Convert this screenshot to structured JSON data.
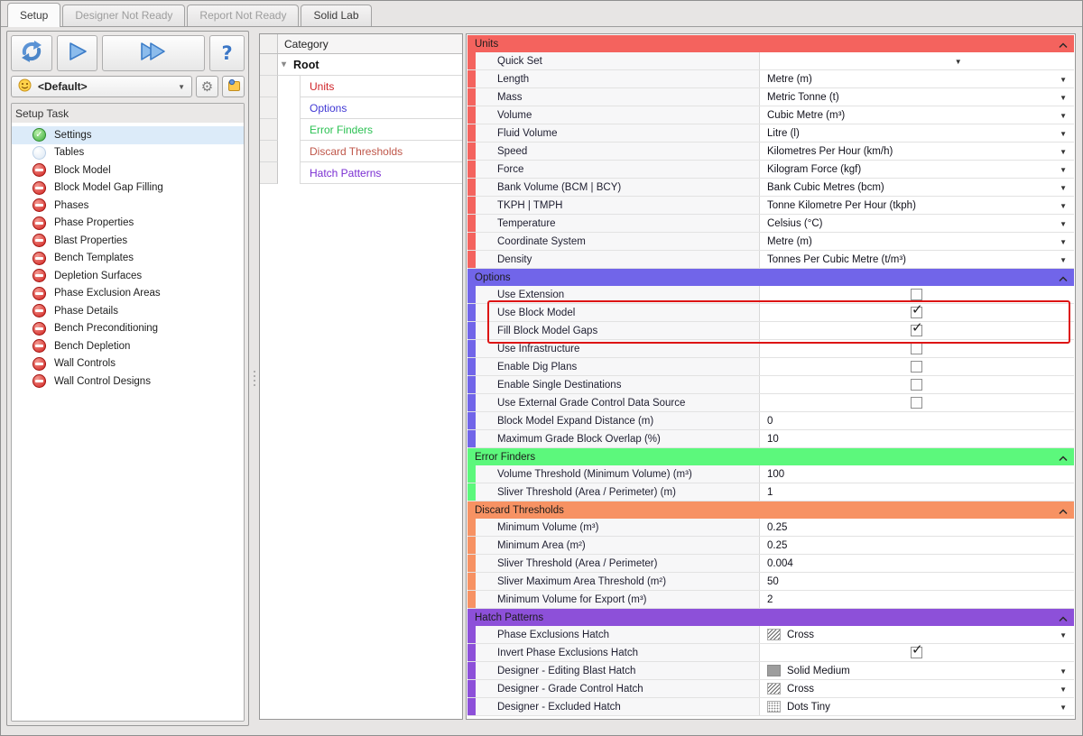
{
  "tabs": [
    {
      "label": "Setup",
      "state": "active"
    },
    {
      "label": "Designer Not Ready",
      "state": "disabled"
    },
    {
      "label": "Report Not Ready",
      "state": "disabled"
    },
    {
      "label": "Solid Lab",
      "state": "normal"
    }
  ],
  "toolbar": {
    "help_glyph": "?",
    "profile": {
      "value": "<Default>"
    }
  },
  "setup_task": {
    "title": "Setup Task",
    "items": [
      {
        "label": "Settings",
        "status": "done",
        "selected": true
      },
      {
        "label": "Tables",
        "status": "pending",
        "selected": false
      },
      {
        "label": "Block Model",
        "status": "blocked",
        "selected": false
      },
      {
        "label": "Block Model Gap Filling",
        "status": "blocked",
        "selected": false
      },
      {
        "label": "Phases",
        "status": "blocked",
        "selected": false
      },
      {
        "label": "Phase Properties",
        "status": "blocked",
        "selected": false
      },
      {
        "label": "Blast Properties",
        "status": "blocked",
        "selected": false
      },
      {
        "label": "Bench Templates",
        "status": "blocked",
        "selected": false
      },
      {
        "label": "Depletion Surfaces",
        "status": "blocked",
        "selected": false
      },
      {
        "label": "Phase Exclusion Areas",
        "status": "blocked",
        "selected": false
      },
      {
        "label": "Phase Details",
        "status": "blocked",
        "selected": false
      },
      {
        "label": "Bench Preconditioning",
        "status": "blocked",
        "selected": false
      },
      {
        "label": "Bench Depletion",
        "status": "blocked",
        "selected": false
      },
      {
        "label": "Wall Controls",
        "status": "blocked",
        "selected": false
      },
      {
        "label": "Wall Control Designs",
        "status": "blocked",
        "selected": false
      }
    ]
  },
  "category_panel": {
    "header": "Category",
    "root": "Root",
    "children": [
      {
        "label": "Units",
        "color": "#cf2429"
      },
      {
        "label": "Options",
        "color": "#4038d4"
      },
      {
        "label": "Error Finders",
        "color": "#2cc153"
      },
      {
        "label": "Discard Thresholds",
        "color": "#bf5649"
      },
      {
        "label": "Hatch Patterns",
        "color": "#7a2ed2"
      }
    ]
  },
  "property_grid": {
    "annotation_color": "#dd1414",
    "sections": [
      {
        "title": "Units",
        "color": "#f4635e",
        "rows": [
          {
            "label": "Quick Set",
            "type": "quickset",
            "value": ""
          },
          {
            "label": "Length",
            "type": "dropdown",
            "value": "Metre (m)"
          },
          {
            "label": "Mass",
            "type": "dropdown",
            "value": "Metric Tonne (t)"
          },
          {
            "label": "Volume",
            "type": "dropdown",
            "value": "Cubic Metre (m³)"
          },
          {
            "label": "Fluid Volume",
            "type": "dropdown",
            "value": "Litre (l)"
          },
          {
            "label": "Speed",
            "type": "dropdown",
            "value": "Kilometres Per Hour (km/h)"
          },
          {
            "label": "Force",
            "type": "dropdown",
            "value": "Kilogram Force (kgf)"
          },
          {
            "label": "Bank Volume (BCM | BCY)",
            "type": "dropdown",
            "value": "Bank Cubic Metres (bcm)"
          },
          {
            "label": "TKPH | TMPH",
            "type": "dropdown",
            "value": "Tonne Kilometre Per Hour (tkph)"
          },
          {
            "label": "Temperature",
            "type": "dropdown",
            "value": "Celsius (°C)"
          },
          {
            "label": "Coordinate System",
            "type": "dropdown",
            "value": "Metre (m)"
          },
          {
            "label": "Density",
            "type": "dropdown",
            "value": "Tonnes Per Cubic Metre (t/m³)"
          }
        ]
      },
      {
        "title": "Options",
        "color": "#7165e9",
        "rows": [
          {
            "label": "Use Extension",
            "type": "checkbox",
            "checked": false
          },
          {
            "label": "Use Block Model",
            "type": "checkbox",
            "checked": true,
            "highlight": true
          },
          {
            "label": "Fill Block Model Gaps",
            "type": "checkbox",
            "checked": true,
            "highlight": true
          },
          {
            "label": "Use Infrastructure",
            "type": "checkbox",
            "checked": false
          },
          {
            "label": "Enable Dig Plans",
            "type": "checkbox",
            "checked": false
          },
          {
            "label": "Enable Single Destinations",
            "type": "checkbox",
            "checked": false
          },
          {
            "label": "Use External Grade Control Data Source",
            "type": "checkbox",
            "checked": false
          },
          {
            "label": "Block Model Expand Distance (m)",
            "type": "text",
            "value": "0"
          },
          {
            "label": "Maximum Grade Block Overlap (%)",
            "type": "text",
            "value": "10"
          }
        ]
      },
      {
        "title": "Error Finders",
        "color": "#5cf87c",
        "rows": [
          {
            "label": "Volume Threshold (Minimum Volume) (m³)",
            "type": "text",
            "value": "100"
          },
          {
            "label": "Sliver Threshold (Area / Perimeter) (m)",
            "type": "text",
            "value": "1"
          }
        ]
      },
      {
        "title": "Discard Thresholds",
        "color": "#f79263",
        "rows": [
          {
            "label": "Minimum Volume (m³)",
            "type": "text",
            "value": "0.25"
          },
          {
            "label": "Minimum Area (m²)",
            "type": "text",
            "value": "0.25"
          },
          {
            "label": "Sliver Threshold (Area / Perimeter)",
            "type": "text",
            "value": "0.004"
          },
          {
            "label": "Sliver Maximum Area Threshold (m²)",
            "type": "text",
            "value": "50"
          },
          {
            "label": "Minimum Volume for Export (m³)",
            "type": "text",
            "value": "2"
          }
        ]
      },
      {
        "title": "Hatch Patterns",
        "color": "#8d50d9",
        "rows": [
          {
            "label": "Phase Exclusions Hatch",
            "type": "hatch",
            "swatch": "cross",
            "value": "Cross"
          },
          {
            "label": "Invert Phase Exclusions Hatch",
            "type": "checkbox",
            "checked": true
          },
          {
            "label": "Designer - Editing Blast Hatch",
            "type": "hatch",
            "swatch": "solid",
            "value": "Solid Medium"
          },
          {
            "label": "Designer - Grade Control Hatch",
            "type": "hatch",
            "swatch": "cross",
            "value": "Cross"
          },
          {
            "label": "Designer - Excluded Hatch",
            "type": "hatch",
            "swatch": "dots",
            "value": "Dots Tiny"
          }
        ]
      }
    ]
  }
}
